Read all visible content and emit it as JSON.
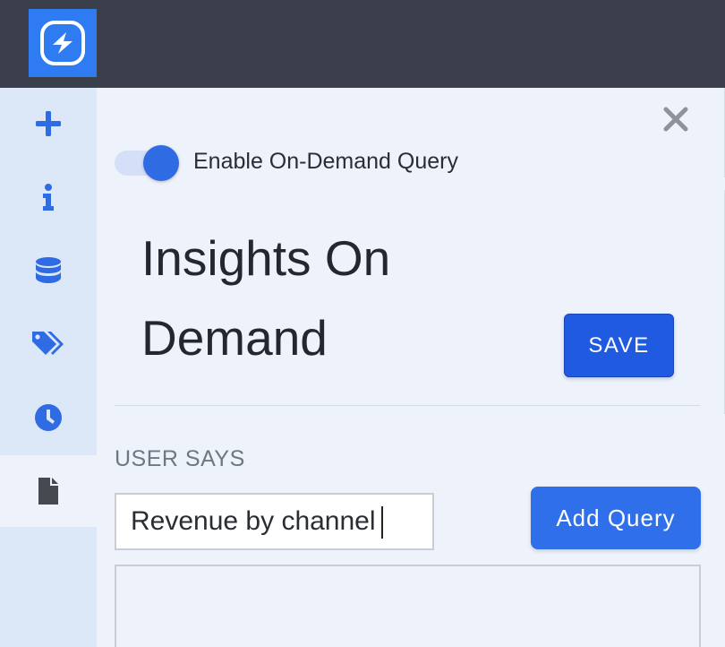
{
  "app": {
    "logo_icon": "lightning-bolt-icon",
    "accent_color": "#2f7cf2",
    "topbar_color": "#3b3f4b"
  },
  "sidebar": {
    "items": [
      {
        "icon": "plus-icon",
        "active": false
      },
      {
        "icon": "info-icon",
        "active": false
      },
      {
        "icon": "database-icon",
        "active": false
      },
      {
        "icon": "tags-icon",
        "active": false
      },
      {
        "icon": "clock-icon",
        "active": false
      },
      {
        "icon": "document-icon",
        "active": true
      }
    ]
  },
  "panel": {
    "close_icon": "close-icon",
    "toggle": {
      "label": "Enable On-Demand Query",
      "enabled": true
    },
    "title": "Insights On Demand",
    "save_label": "SAVE",
    "section_label": "USER SAYS",
    "query_input": {
      "value": "Revenue by channel"
    },
    "add_query_label": "Add Query"
  }
}
